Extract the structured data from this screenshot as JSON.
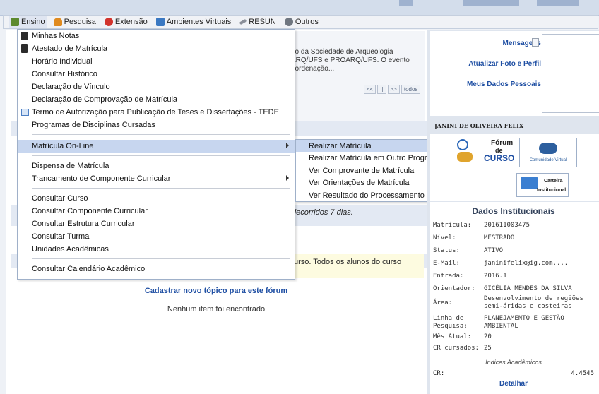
{
  "menubar": {
    "items": [
      {
        "label": "Ensino",
        "icon": "books-icon",
        "color": "#5d8a2e"
      },
      {
        "label": "Pesquisa",
        "icon": "flask-icon",
        "color": "#e08a1e"
      },
      {
        "label": "Extensão",
        "icon": "heart-hand-icon",
        "color": "#d2332c"
      },
      {
        "label": "Ambientes Virtuais",
        "icon": "monitor-icon",
        "color": "#3a78c2"
      },
      {
        "label": "RESUN",
        "icon": "pen-icon",
        "color": "#8a8f99"
      },
      {
        "label": "Outros",
        "icon": "gear-icon",
        "color": "#6f7680"
      }
    ]
  },
  "dropdown": {
    "items": [
      {
        "label": "Minhas Notas",
        "icon": "document-icon"
      },
      {
        "label": "Atestado de Matrícula",
        "icon": "document-icon"
      },
      {
        "label": "Horário Individual"
      },
      {
        "label": "Consultar Histórico"
      },
      {
        "label": "Declaração de Vínculo"
      },
      {
        "label": "Declaração de Comprovação de Matrícula"
      },
      {
        "label": "Termo de Autorização para Publicação de Teses e Dissertações - TEDE",
        "icon": "window-icon"
      },
      {
        "label": "Programas de Disciplinas Cursadas"
      },
      {
        "label": "Matrícula On-Line",
        "submenu": true,
        "highlighted": true
      },
      {
        "label": "Dispensa de Matrícula"
      },
      {
        "label": "Trancamento de Componente Curricular",
        "submenu": true
      },
      {
        "label": "Consultar Curso"
      },
      {
        "label": "Consultar Componente Curricular"
      },
      {
        "label": "Consultar Estrutura Curricular"
      },
      {
        "label": "Consultar Turma"
      },
      {
        "label": "Unidades Acadêmicas"
      },
      {
        "label": "Consultar Calendário Acadêmico"
      }
    ]
  },
  "submenu": {
    "items": [
      {
        "label": "Realizar Matrícula",
        "highlighted": true
      },
      {
        "label": "Realizar Matrícula em Outro Programa"
      },
      {
        "label": "Ver Comprovante de Matrícula"
      },
      {
        "label": "Ver Orientações de Matrícula"
      },
      {
        "label": "Ver Resultado do Processamento"
      }
    ]
  },
  "content": {
    "news_lines": [
      "ão da Sociedade de Arqueologia",
      "ARQ/UFS e PROARQ/UFS. O evento",
      "oordenação..."
    ],
    "pager": [
      "<<",
      "||",
      ">>",
      "todos"
    ],
    "days_text": "decorridos 7 dias.",
    "yellow_text": "urso. Todos os alunos do curso",
    "new_topic_link": "Cadastrar novo tópico para este fórum",
    "empty_text": "Nenhum item foi encontrado"
  },
  "right": {
    "links": [
      "Mensagens",
      "Atualizar Foto e Perfil",
      "Meus Dados Pessoais"
    ],
    "student_name": "JANINI DE OLIVEIRA FELIX",
    "forum_badge": {
      "line1": "Fórum",
      "line2": "de",
      "line3": "CURSO"
    },
    "community_badge": "Comunidade Virtual",
    "card_badge": {
      "line1": "Carteira",
      "line2": "Institucional"
    },
    "inst_title": "Dados Institucionais",
    "fields": [
      {
        "k": "Matrícula:",
        "v": "201611003475"
      },
      {
        "k": "Nível:",
        "v": "MESTRADO"
      },
      {
        "k": "Status:",
        "v": "ATIVO"
      },
      {
        "k": "E-Mail:",
        "v": "janinifelix@ig.com...."
      },
      {
        "k": "Entrada:",
        "v": "2016.1"
      },
      {
        "k": "Orientador:",
        "v": "GICÉLIA MENDES DA SILVA"
      },
      {
        "k": "Área:",
        "v": "Desenvolvimento de regiões semi-áridas e costeiras"
      },
      {
        "k": "Linha de Pesquisa:",
        "v": "PLANEJAMENTO E GESTÃO AMBIENTAL"
      },
      {
        "k": "Mês Atual:",
        "v": "20"
      },
      {
        "k": "CR cursados:",
        "v": "25"
      }
    ],
    "indices_label": "Índices Acadêmicos",
    "cr_label": "CR:",
    "cr_value": "4.4545",
    "detalhar": "Detalhar"
  }
}
